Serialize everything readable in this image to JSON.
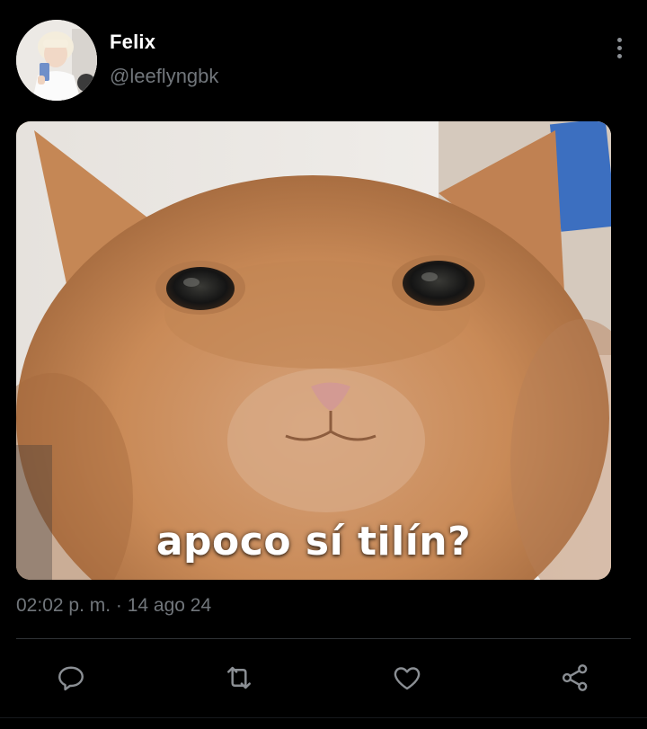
{
  "tweet": {
    "display_name": "Felix",
    "handle": "@leeflyngbk",
    "timestamp": "02:02 p. m. · 14 ago 24",
    "media_caption": "apoco sí tilín?"
  },
  "icons": {
    "more": "more-vertical-icon",
    "reply": "reply-icon",
    "retweet": "retweet-icon",
    "like": "heart-icon",
    "share": "share-icon"
  },
  "colors": {
    "background": "#000000",
    "primary_text": "#ffffff",
    "secondary_text": "#71767b",
    "divider": "#2f3336",
    "icon": "#8b8f94"
  }
}
